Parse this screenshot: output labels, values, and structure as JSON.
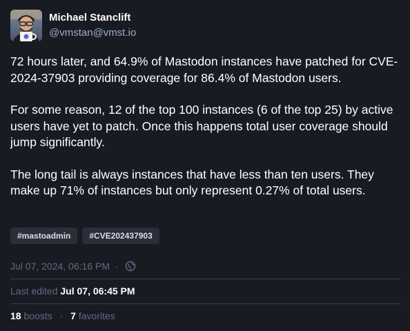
{
  "author": {
    "display_name": "Michael Stanclift",
    "handle": "@vmstan@vmst.io"
  },
  "content": {
    "paragraphs": [
      "72 hours later, and 64.9% of Mastodon instances have patched for CVE-2024-37903 providing coverage for 86.4% of Mastodon users.",
      "For some reason, 12 of the top 100 instances (6 of the top 25) by active users have yet to patch. Once this happens total user coverage should jump significantly.",
      "The long tail is always instances that have less than ten users. They make up 71% of instances but only represent 0.27% of total users."
    ]
  },
  "hashtags": [
    "#mastoadmin",
    "#CVE202437903"
  ],
  "meta": {
    "timestamp": "Jul 07, 2024, 06:16 PM",
    "separator": "·",
    "visibility_icon": "globe-icon"
  },
  "edit": {
    "label": "Last edited",
    "time": "Jul 07, 06:45 PM"
  },
  "stats": {
    "boosts_count": "18",
    "boosts_label": "boosts",
    "separator": "·",
    "favorites_count": "7",
    "favorites_label": "favorites"
  },
  "colors": {
    "background": "#191b22",
    "text": "#ffffff",
    "muted": "#606984",
    "handle": "#9baec8",
    "tag_bg": "#2b2e39",
    "divider": "#393f4f"
  }
}
